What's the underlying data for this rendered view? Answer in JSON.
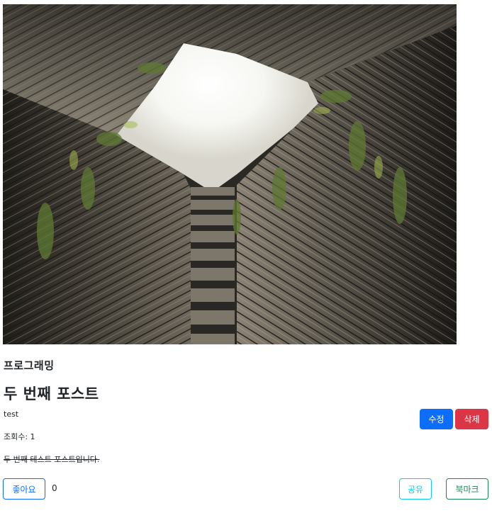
{
  "post": {
    "category": "프로그래밍",
    "title": "두 번째 포스트",
    "author": "test",
    "views": "조회수: 1",
    "content": "두 번째 테스트 포스트입니다."
  },
  "actions": {
    "edit_label": "수정",
    "delete_label": "삭제",
    "like_label": "좋아요",
    "like_count": "0",
    "share_label": "공유",
    "bookmark_label": "북마크"
  },
  "colors": {
    "primary": "#0d6efd",
    "danger": "#dc3545",
    "info": "#0dcaf0",
    "success": "#198754"
  }
}
